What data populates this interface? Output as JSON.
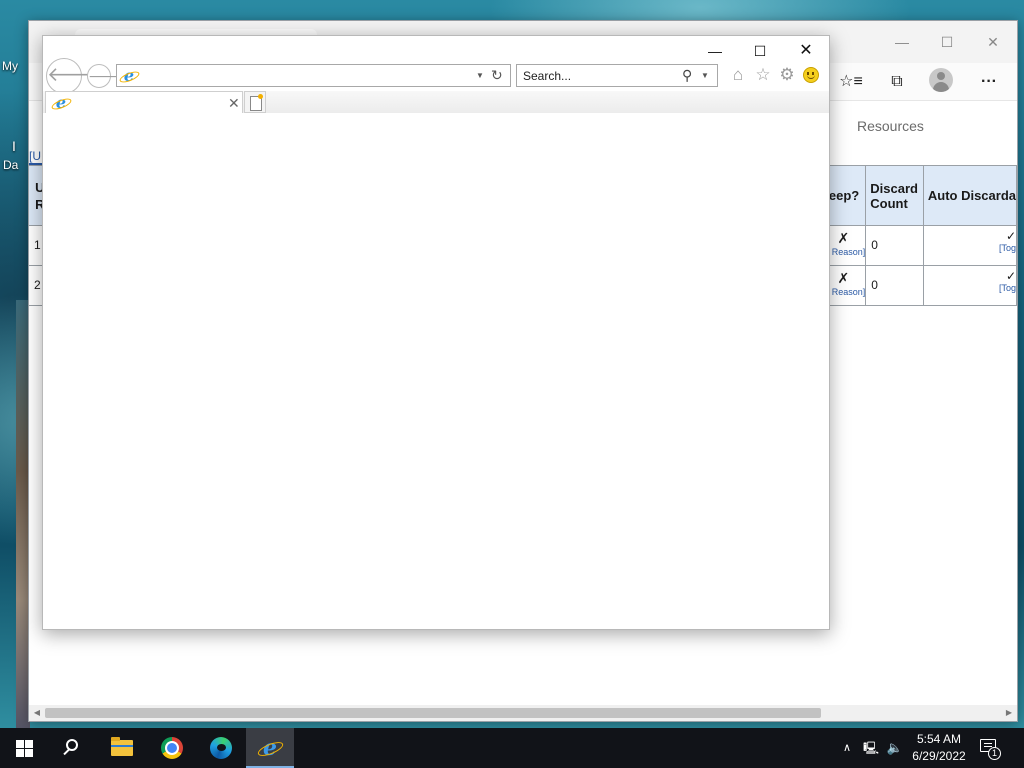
{
  "desktop": {
    "icon_labels": [
      "My",
      "I",
      "Da"
    ]
  },
  "edge_window": {
    "controls": {
      "minimize": "—",
      "maximize": "☐",
      "close": "✕"
    },
    "toolbar": {
      "favorites_icon": "☆≡",
      "collections_icon": "⧉",
      "more_icon": "···"
    },
    "nav": {
      "resources": "Resources",
      "left_link": "[U"
    },
    "table_left": {
      "header_lines": [
        "U",
        "R"
      ],
      "rows": [
        "1",
        "2"
      ]
    },
    "table_right": {
      "headers": {
        "keep": "eep?",
        "discard_count": "Discard Count",
        "auto_discard": "Auto Discarda"
      },
      "rows": [
        {
          "keep_mark": "✗",
          "keep_link": "Reason]",
          "discard_count": "0",
          "auto_mark": "✓",
          "auto_link": "[Tog"
        },
        {
          "keep_mark": "✗",
          "keep_link": "Reason]",
          "discard_count": "0",
          "auto_mark": "✓",
          "auto_link": "[Tog"
        }
      ]
    },
    "scrollbar": {
      "left_arrow": "◀",
      "right_arrow": "▶"
    }
  },
  "ie_window": {
    "controls": {
      "minimize": "—",
      "maximize": "☐",
      "close": "✕"
    },
    "nav": {
      "back_icon": "🡐",
      "forward_icon": "🡒"
    },
    "address": {
      "value": "",
      "dropdown_icon": "▼",
      "refresh_icon": "↻",
      "logo_letter": "e"
    },
    "search": {
      "placeholder": "Search...",
      "glass_icon": "⚲",
      "dropdown_icon": "▼"
    },
    "tools": {
      "home_icon": "⌂",
      "favorites_icon": "☆",
      "settings_icon": "⚙"
    },
    "tab": {
      "title": "",
      "close_icon": "✕",
      "logo_letter": "e"
    }
  },
  "taskbar": {
    "ie_logo_letter": "e",
    "tray": {
      "chevron": "∧",
      "network": "🖳",
      "volume": "🔈"
    },
    "clock": {
      "time": "5:54 AM",
      "date": "6/29/2022"
    },
    "notifications": {
      "count": "1"
    }
  }
}
